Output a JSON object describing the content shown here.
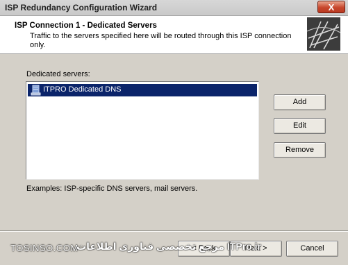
{
  "window": {
    "title": "ISP Redundancy Configuration Wizard",
    "close_glyph": "X"
  },
  "header": {
    "title": "ISP Connection 1 - Dedicated Servers",
    "subtitle": "Traffic to the servers specified here will be routed through this ISP connection only."
  },
  "main": {
    "list_label": "Dedicated servers:",
    "items": [
      {
        "label": "ITPRO Dedicated DNS",
        "selected": true,
        "icon": "server-icon"
      }
    ],
    "examples": "Examples: ISP-specific DNS servers, mail servers."
  },
  "side_buttons": {
    "add": "Add",
    "edit": "Edit",
    "remove": "Remove"
  },
  "footer": {
    "back": "< Back",
    "next": "Next >",
    "cancel": "Cancel"
  },
  "watermark": {
    "left": "TOSINSO.COM",
    "right": "مرجع تخصصی فناوری اطلاعات ITPro.ir"
  },
  "colors": {
    "selection": "#0b246a",
    "dialog_bg": "#d4d0c8",
    "close_button": "#c8472d"
  }
}
